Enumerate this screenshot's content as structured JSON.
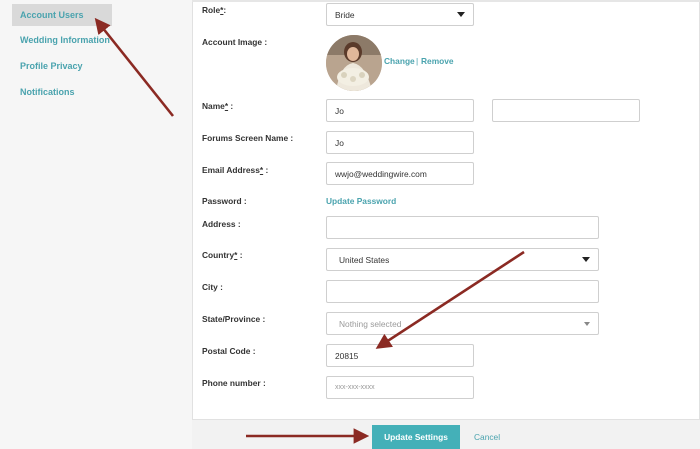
{
  "sidebar": {
    "items": [
      {
        "label": "Account Users"
      },
      {
        "label": "Wedding Information"
      },
      {
        "label": "Profile Privacy"
      },
      {
        "label": "Notifications"
      }
    ]
  },
  "form": {
    "role": {
      "label": "Role",
      "suffix": ":",
      "value": "Bride"
    },
    "account_image": {
      "label": "Account Image :",
      "change": "Change",
      "separator": "|",
      "remove": "Remove"
    },
    "name": {
      "label": "Name",
      "suffix": " :",
      "first": "Jo",
      "last": ""
    },
    "forums_name": {
      "label": "Forums Screen Name :",
      "value": "Jo"
    },
    "email": {
      "label": "Email Address",
      "suffix": " :",
      "value": "wwjo@weddingwire.com"
    },
    "password": {
      "label": "Password :",
      "link": "Update Password"
    },
    "address": {
      "label": "Address :",
      "value": ""
    },
    "country": {
      "label": "Country",
      "suffix": " :",
      "value": "United States"
    },
    "city": {
      "label": "City :",
      "value": ""
    },
    "state": {
      "label": "State/Province :",
      "value": "Nothing selected"
    },
    "postal": {
      "label": "Postal Code :",
      "value": "20815"
    },
    "phone": {
      "label": "Phone number :",
      "placeholder": "xxx-xxx-xxxx"
    },
    "required_mark": "*"
  },
  "footer": {
    "update_label": "Update Settings",
    "cancel_label": "Cancel"
  },
  "colors": {
    "accent": "#44b0b8",
    "link": "#4aa3ae",
    "annotation_arrow": "#8b2a23"
  }
}
